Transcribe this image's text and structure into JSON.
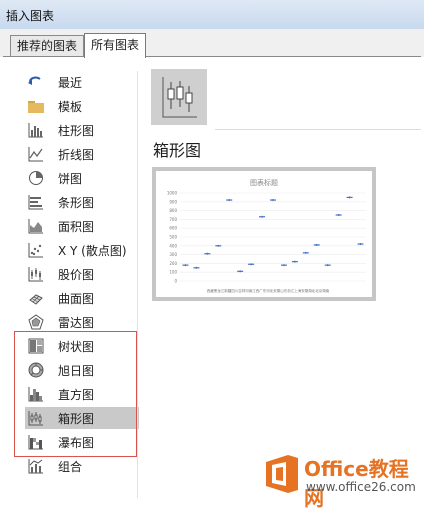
{
  "window": {
    "title": "插入图表"
  },
  "tabs": [
    {
      "label": "推荐的图表"
    },
    {
      "label": "所有图表"
    }
  ],
  "sidebar": {
    "items": [
      {
        "label": "最近",
        "icon": "recent-icon"
      },
      {
        "label": "模板",
        "icon": "folder-icon"
      },
      {
        "label": "柱形图",
        "icon": "column-chart-icon"
      },
      {
        "label": "折线图",
        "icon": "line-chart-icon"
      },
      {
        "label": "饼图",
        "icon": "pie-chart-icon"
      },
      {
        "label": "条形图",
        "icon": "bar-chart-icon"
      },
      {
        "label": "面积图",
        "icon": "area-chart-icon"
      },
      {
        "label": "X Y (散点图)",
        "icon": "scatter-chart-icon"
      },
      {
        "label": "股价图",
        "icon": "stock-chart-icon"
      },
      {
        "label": "曲面图",
        "icon": "surface-chart-icon"
      },
      {
        "label": "雷达图",
        "icon": "radar-chart-icon"
      },
      {
        "label": "树状图",
        "icon": "treemap-chart-icon"
      },
      {
        "label": "旭日图",
        "icon": "sunburst-chart-icon"
      },
      {
        "label": "直方图",
        "icon": "histogram-chart-icon"
      },
      {
        "label": "箱形图",
        "icon": "box-whisker-chart-icon"
      },
      {
        "label": "瀑布图",
        "icon": "waterfall-chart-icon"
      },
      {
        "label": "组合",
        "icon": "combo-chart-icon"
      }
    ],
    "selected": "箱形图"
  },
  "main": {
    "heading": "箱形图",
    "preview": {
      "title": "图表标题",
      "y_ticks": [
        "1000",
        "900",
        "800",
        "700",
        "600",
        "500",
        "400",
        "300",
        "200",
        "100",
        "0"
      ],
      "x_caption": "西藏黑龙江新疆四川吉林河南江西广东河北安徽山东浙江上海安徽湖北北京湖南"
    }
  },
  "watermark": {
    "brand": "Office教程网",
    "url": "www.office26.com"
  },
  "colors": {
    "accent": "#4472c4",
    "selection": "#c9c9c9",
    "highlight_box": "#d9534f",
    "logo_orange": "#e57323"
  },
  "chart_data": {
    "type": "box",
    "title": "图表标题",
    "ylim": [
      0,
      1000
    ],
    "values": [
      180,
      150,
      310,
      400,
      920,
      110,
      190,
      730,
      920,
      180,
      220,
      320,
      410,
      180,
      750,
      950,
      420
    ]
  }
}
